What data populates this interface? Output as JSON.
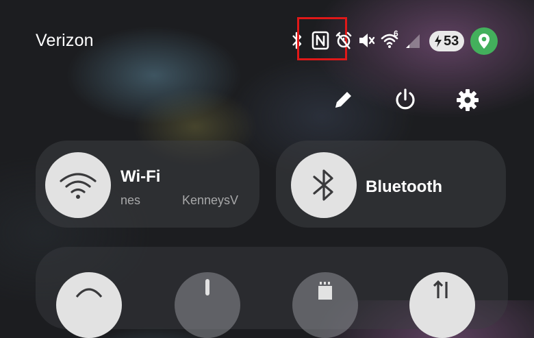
{
  "status_bar": {
    "carrier": "Verizon",
    "icons": [
      "bluetooth-icon",
      "nfc-icon",
      "alarm-icon",
      "mute-icon",
      "wifi-6-icon",
      "cell-signal-icon"
    ],
    "wifi_badge": "6",
    "battery": {
      "level": "53",
      "charging": true
    },
    "location_color": "#43b05c",
    "highlight_color": "#e01818"
  },
  "actions": [
    "edit-icon",
    "power-icon",
    "settings-icon"
  ],
  "tiles": {
    "wifi": {
      "label": "Wi-Fi",
      "sub_left": "nes",
      "sub_right": "KenneysV"
    },
    "bluetooth": {
      "label": "Bluetooth"
    }
  }
}
